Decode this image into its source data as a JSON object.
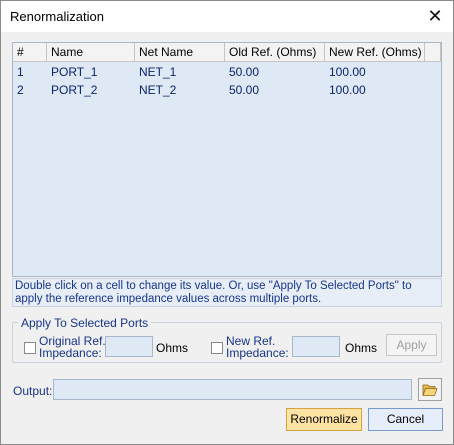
{
  "window": {
    "title": "Renormalization"
  },
  "grid": {
    "columns": [
      "#",
      "Name",
      "Net Name",
      "Old Ref. (Ohms)",
      "New Ref. (Ohms)"
    ],
    "rows": [
      [
        "1",
        "PORT_1",
        "NET_1",
        "50.00",
        "100.00"
      ],
      [
        "2",
        "PORT_2",
        "NET_2",
        "50.00",
        "100.00"
      ]
    ]
  },
  "hint": "Double click on a cell to change its value. Or, use \"Apply To Selected Ports\" to apply the reference impedance values across  multiple ports.",
  "apply_group": {
    "title": "Apply To Selected Ports",
    "original_label_1": "Original Ref.",
    "original_label_2": "Impedance:",
    "original_value": "",
    "original_unit": "Ohms",
    "new_label_1": "New Ref.",
    "new_label_2": "Impedance:",
    "new_value": "",
    "new_unit": "Ohms",
    "apply_label": "Apply"
  },
  "output": {
    "label": "Output:",
    "value": ""
  },
  "buttons": {
    "renormalize": "Renormalize",
    "cancel": "Cancel"
  },
  "icons": {
    "close": "close-icon",
    "folder": "folder-open-icon"
  }
}
